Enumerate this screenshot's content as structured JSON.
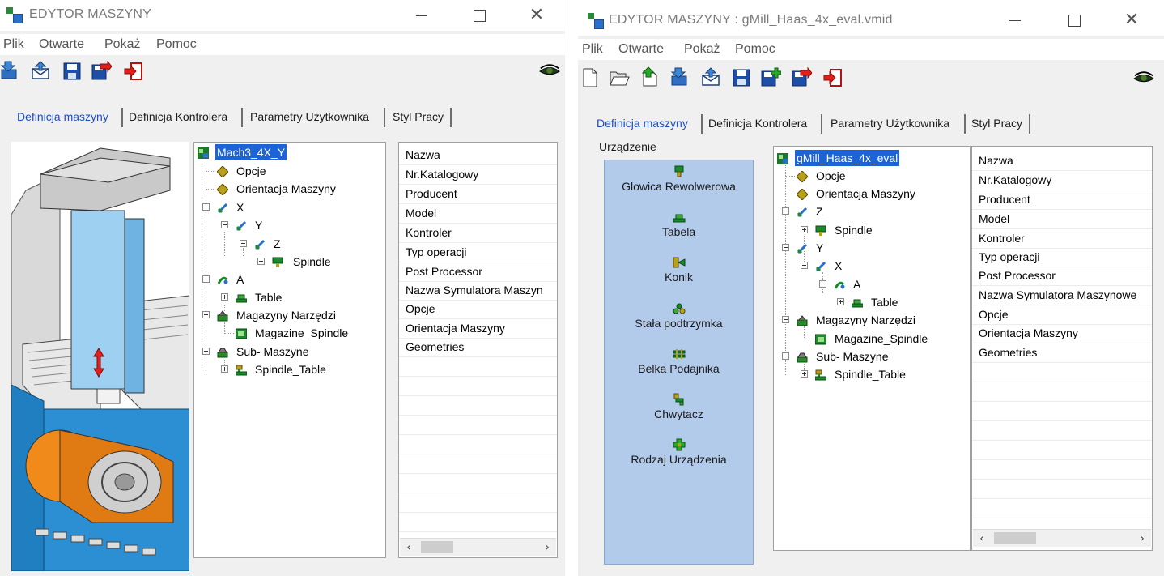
{
  "left": {
    "title": "EDYTOR MASZYNY",
    "menu": [
      "Plik",
      "Otwarte",
      "Pokaż",
      "Pomoc"
    ],
    "toolbar": [
      "import-icon",
      "export-icon",
      "save-icon",
      "save-as-icon",
      "exit-icon"
    ],
    "tabs": [
      "Definicja maszyny",
      "Definicja Kontrolera",
      "Parametry Użytkownika",
      "Styl Pracy"
    ],
    "active_tab": "Definicja maszyny",
    "tree": [
      {
        "label": "Mach3_4X_Y",
        "icon": "machine-icon",
        "selected": true
      },
      {
        "label": "Opcje",
        "icon": "diamond-icon"
      },
      {
        "label": "Orientacja Maszyny",
        "icon": "diamond-icon"
      },
      {
        "label": "X",
        "icon": "axis-icon"
      },
      {
        "label": "Y",
        "icon": "axis-icon"
      },
      {
        "label": "Z",
        "icon": "axis-icon"
      },
      {
        "label": "Spindle",
        "icon": "spindle-icon"
      },
      {
        "label": "A",
        "icon": "rotary-axis-icon"
      },
      {
        "label": "Table",
        "icon": "table-icon"
      },
      {
        "label": "Magazyny Narzędzi",
        "icon": "tool-magazine-icon"
      },
      {
        "label": "Magazine_Spindle",
        "icon": "magazine-icon"
      },
      {
        "label": "Sub- Maszyne",
        "icon": "sub-machine-icon"
      },
      {
        "label": "Spindle_Table",
        "icon": "spindle-table-icon"
      }
    ],
    "properties": [
      "Nazwa",
      "Nr.Katalogowy",
      "Producent",
      "Model",
      "Kontroler",
      "Typ operacji",
      "Post Processor",
      "Nazwa Symulatora Maszyn",
      "Opcje",
      "Orientacja Maszyny",
      "Geometries"
    ]
  },
  "right": {
    "title": "EDYTOR MASZYNY : gMill_Haas_4x_eval.vmid",
    "menu": [
      "Plik",
      "Otwarte",
      "Pokaż",
      "Pomoc"
    ],
    "toolbar": [
      "new-icon",
      "open-icon",
      "import-green-icon",
      "import-icon",
      "export-icon",
      "save-icon",
      "save-add-icon",
      "save-as-icon",
      "exit-icon"
    ],
    "tabs": [
      "Definicja maszyny",
      "Definicja Kontrolera",
      "Parametry Użytkownika",
      "Styl Pracy"
    ],
    "active_tab": "Definicja maszyny",
    "group_label": "Urządzenie",
    "devices": [
      {
        "label": "Glowica Rewolwerowa",
        "icon": "turret-icon"
      },
      {
        "label": "Tabela",
        "icon": "table-icon"
      },
      {
        "label": "Konik",
        "icon": "tailstock-icon"
      },
      {
        "label": "Stała podtrzymka",
        "icon": "steady-rest-icon"
      },
      {
        "label": "Belka Podajnika",
        "icon": "feeder-bar-icon"
      },
      {
        "label": "Chwytacz",
        "icon": "gripper-icon"
      },
      {
        "label": "Rodzaj Urządzenia",
        "icon": "device-type-icon"
      }
    ],
    "tree": [
      {
        "label": "gMill_Haas_4x_eval",
        "icon": "machine-icon",
        "selected": true
      },
      {
        "label": "Opcje",
        "icon": "diamond-icon"
      },
      {
        "label": "Orientacja Maszyny",
        "icon": "diamond-icon"
      },
      {
        "label": "Z",
        "icon": "axis-icon"
      },
      {
        "label": "Spindle",
        "icon": "spindle-icon"
      },
      {
        "label": "Y",
        "icon": "axis-icon"
      },
      {
        "label": "X",
        "icon": "axis-icon"
      },
      {
        "label": "A",
        "icon": "rotary-axis-icon"
      },
      {
        "label": "Table",
        "icon": "table-icon"
      },
      {
        "label": "Magazyny Narzędzi",
        "icon": "tool-magazine-icon"
      },
      {
        "label": "Magazine_Spindle",
        "icon": "magazine-icon"
      },
      {
        "label": "Sub- Maszyne",
        "icon": "sub-machine-icon"
      },
      {
        "label": "Spindle_Table",
        "icon": "spindle-table-icon"
      }
    ],
    "properties": [
      "Nazwa",
      "Nr.Katalogowy",
      "Producent",
      "Model",
      "Kontroler",
      "Typ operacji",
      "Post Processor",
      "Nazwa Symulatora Maszynowe",
      "Opcje",
      "Orientacja Maszyny",
      "Geometries"
    ]
  }
}
